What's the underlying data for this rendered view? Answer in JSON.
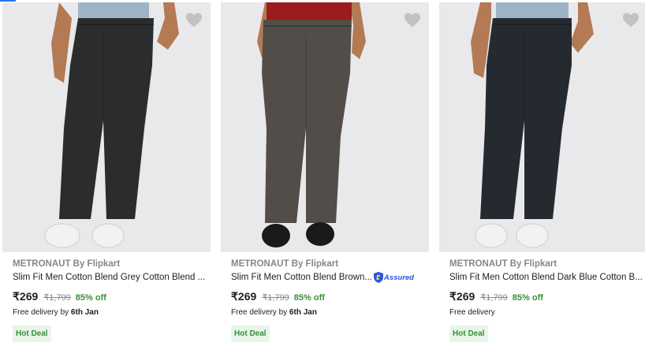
{
  "products": [
    {
      "brand": "METRONAUT By Flipkart",
      "title": "Slim Fit Men Cotton Blend Grey Cotton Blend ...",
      "price": "₹269",
      "mrp": "₹1,799",
      "discount": "85% off",
      "delivery_prefix": "Free delivery by ",
      "delivery_date": "6th Jan",
      "badge": "Hot Deal",
      "assured": false,
      "shirt_color": "#9fb3c8",
      "pant_color": "#2b2c2e",
      "shoe_color": "#f2f2f2",
      "shoe_icon": "white-sneaker"
    },
    {
      "brand": "METRONAUT By Flipkart",
      "title": "Slim Fit Men Cotton Blend Brown...",
      "price": "₹269",
      "mrp": "₹1,799",
      "discount": "85% off",
      "delivery_prefix": "Free delivery by ",
      "delivery_date": "6th Jan",
      "badge": "Hot Deal",
      "assured": true,
      "assured_text": "Assured",
      "shirt_color": "#9b1c1c",
      "pant_color": "#524d48",
      "shoe_color": "#1a1a1a",
      "shoe_icon": "black-sneaker"
    },
    {
      "brand": "METRONAUT By Flipkart",
      "title": "Slim Fit Men Cotton Blend Dark Blue Cotton B...",
      "price": "₹269",
      "mrp": "₹1,799",
      "discount": "85% off",
      "delivery_prefix": "Free delivery",
      "delivery_date": "",
      "badge": "Hot Deal",
      "assured": false,
      "shirt_color": "#9fb3c8",
      "pant_color": "#252a30",
      "shoe_color": "#f2f2f2",
      "shoe_icon": "white-sneaker"
    }
  ],
  "colors": {
    "accent": "#2874f0",
    "discount_green": "#388e3c",
    "deal_bg": "#e8f5e9",
    "image_bg": "#e9e9ec",
    "heart_grey": "#c2c2c2"
  },
  "icons": {
    "wishlist": "heart-icon",
    "assured": "flipkart-assured-icon"
  }
}
